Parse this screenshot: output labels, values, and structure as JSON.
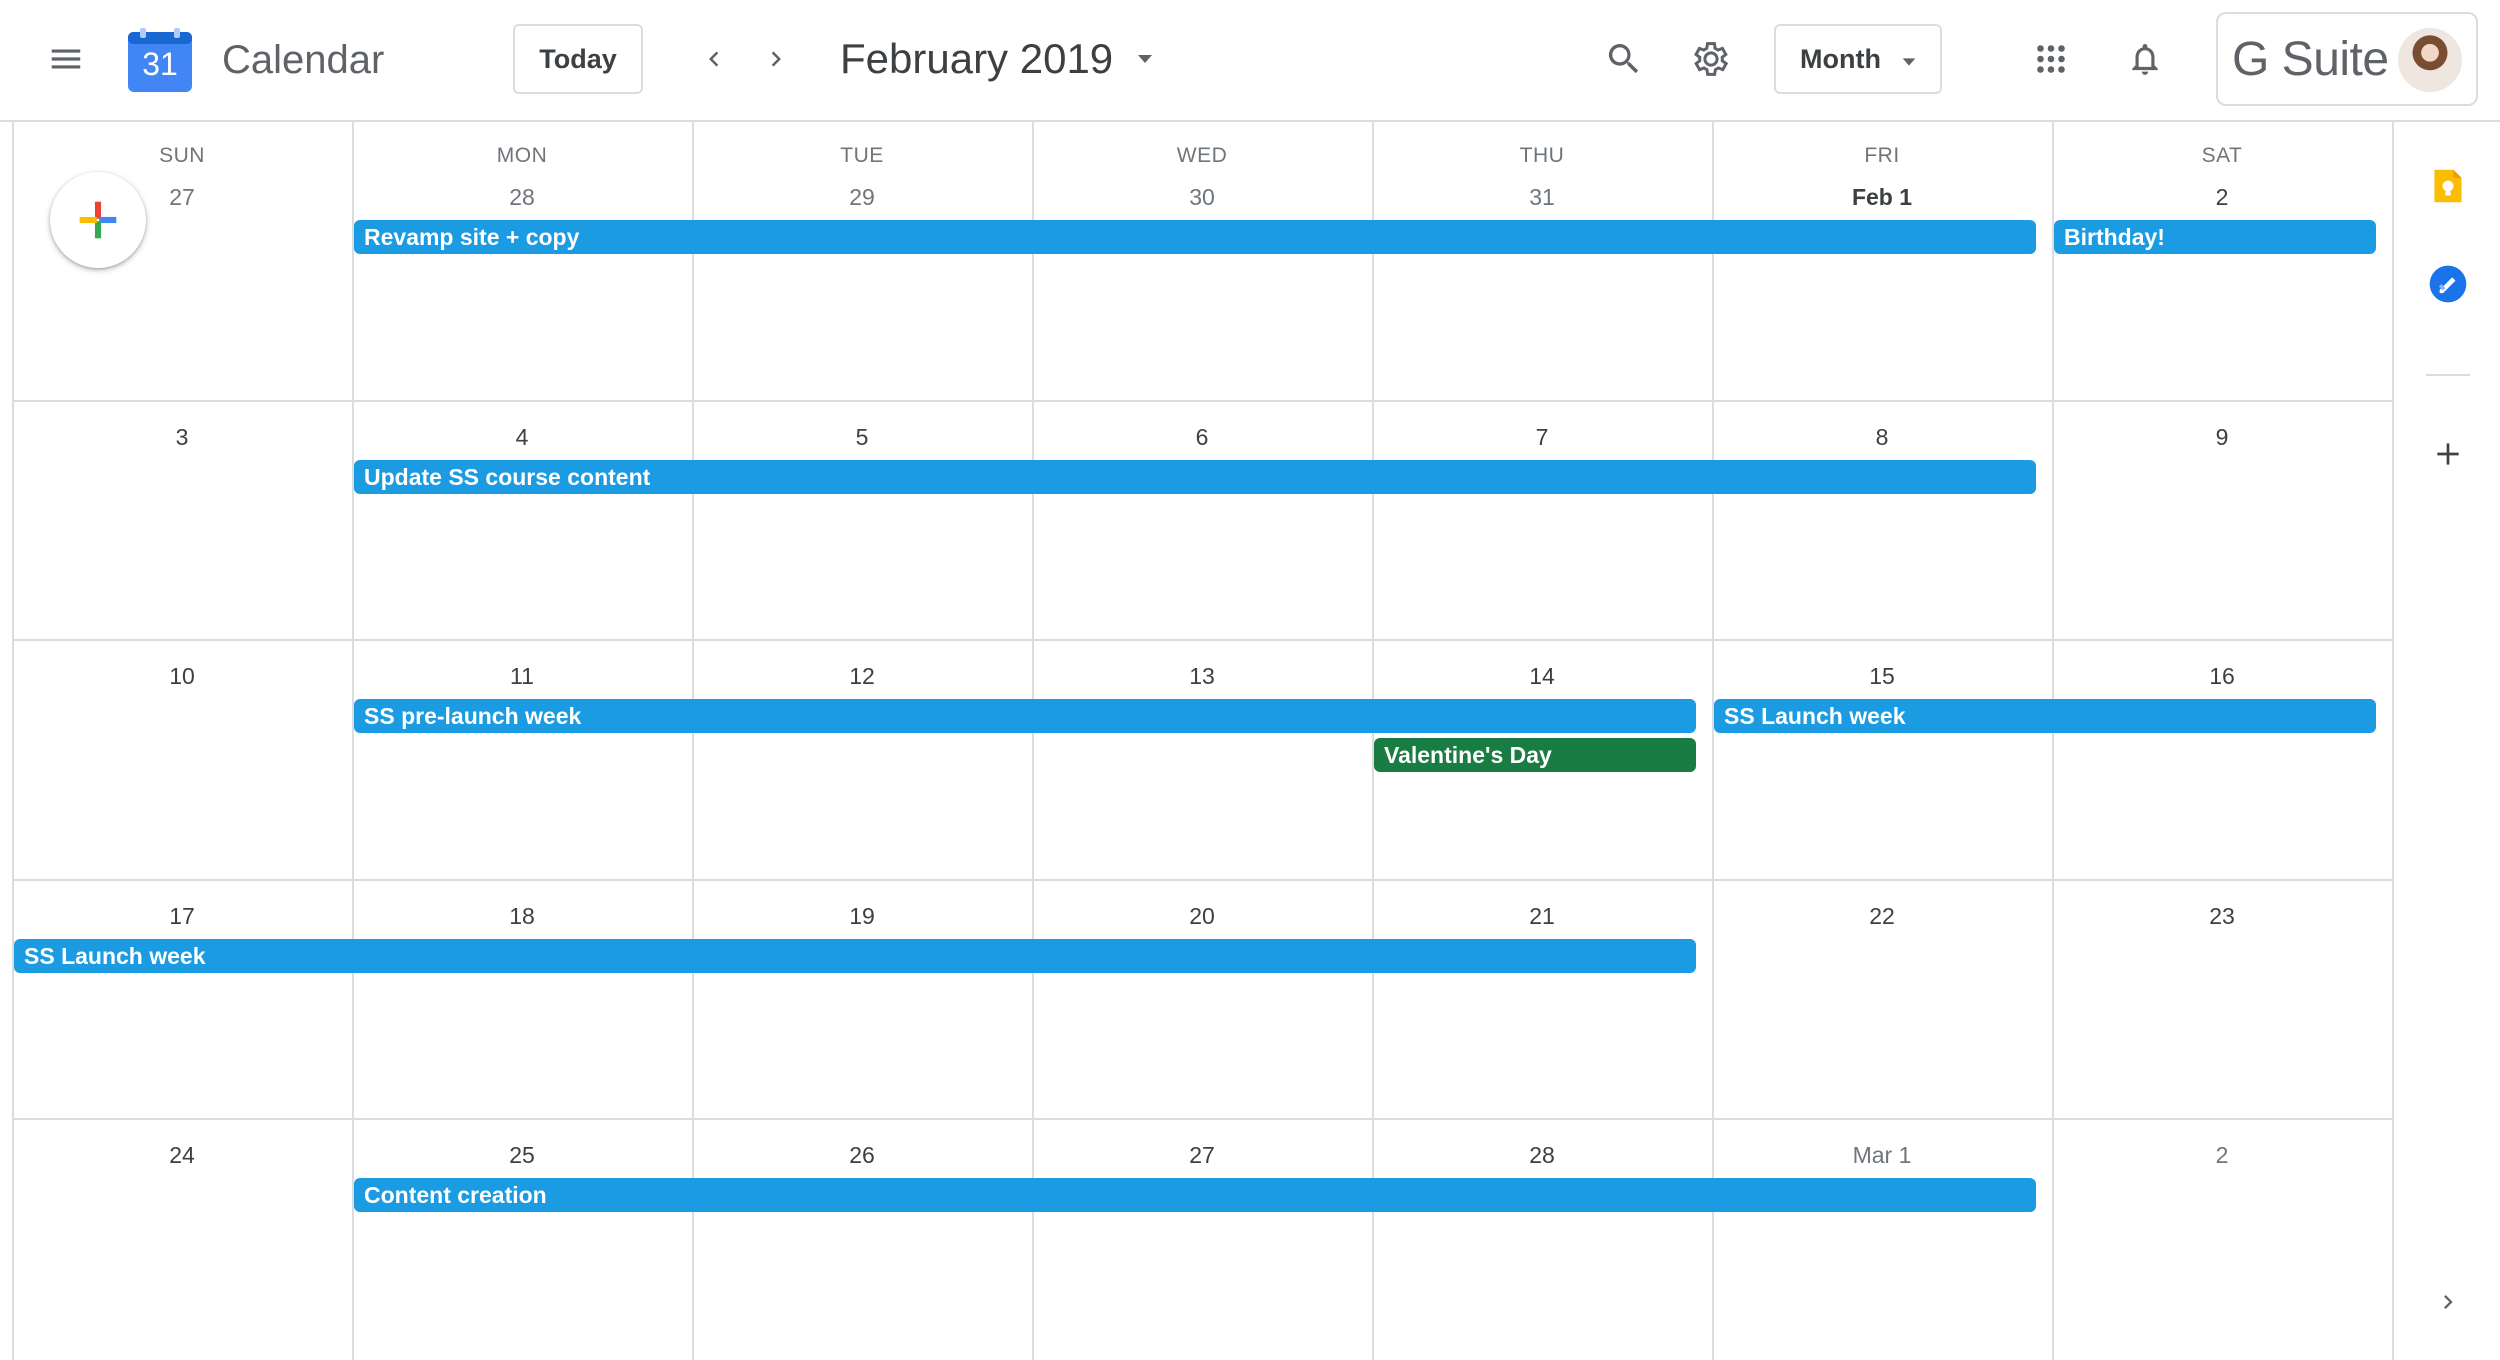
{
  "header": {
    "app_title": "Calendar",
    "logo_day": "31",
    "today_label": "Today",
    "period": "February 2019",
    "view": "Month",
    "brand": "G Suite",
    "icons": [
      "menu-icon",
      "search-icon",
      "settings-icon",
      "apps-icon",
      "bell-icon"
    ]
  },
  "colors": {
    "event_blue": "#1a9be2",
    "event_green": "#197d43",
    "logo_blue": "#4285f4"
  },
  "days_of_week": [
    "SUN",
    "MON",
    "TUE",
    "WED",
    "THU",
    "FRI",
    "SAT"
  ],
  "weeks": [
    [
      "27",
      "28",
      "29",
      "30",
      "31",
      "Feb 1",
      "2"
    ],
    [
      "3",
      "4",
      "5",
      "6",
      "7",
      "8",
      "9"
    ],
    [
      "10",
      "11",
      "12",
      "13",
      "14",
      "15",
      "16"
    ],
    [
      "17",
      "18",
      "19",
      "20",
      "21",
      "22",
      "23"
    ],
    [
      "24",
      "25",
      "26",
      "27",
      "28",
      "Mar 1",
      "2"
    ]
  ],
  "events": [
    {
      "title": "Revamp site + copy",
      "week": 0,
      "start": 1,
      "end": 5,
      "color": "blue"
    },
    {
      "title": "Birthday!",
      "week": 0,
      "start": 6,
      "end": 6,
      "color": "blue"
    },
    {
      "title": "Update SS course content",
      "week": 1,
      "start": 1,
      "end": 5,
      "color": "blue"
    },
    {
      "title": "SS pre-launch week",
      "week": 2,
      "start": 1,
      "end": 4,
      "color": "blue"
    },
    {
      "title": "SS Launch week",
      "week": 2,
      "start": 5,
      "end": 6,
      "color": "blue"
    },
    {
      "title": "Valentine's Day",
      "week": 2,
      "start": 4,
      "end": 4,
      "color": "green"
    },
    {
      "title": "SS Launch week",
      "week": 3,
      "start": 0,
      "end": 4,
      "color": "blue"
    },
    {
      "title": "Content creation",
      "week": 4,
      "start": 1,
      "end": 5,
      "color": "blue"
    }
  ],
  "side_panel": {
    "icons": [
      "keep-icon",
      "tasks-icon",
      "add-icon",
      "chevron-right-icon"
    ]
  }
}
